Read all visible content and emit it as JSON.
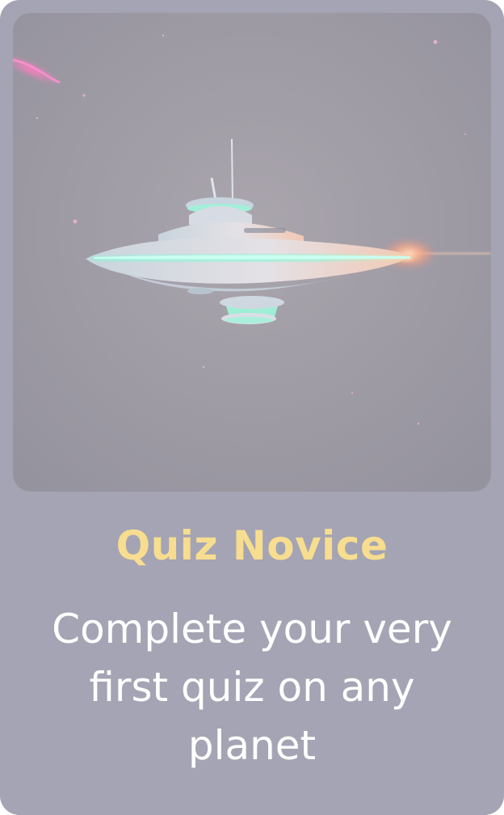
{
  "achievement": {
    "title": "Quiz Novice",
    "description": "Complete your very first quiz on any planet",
    "image_alt": "spaceship-illustration"
  },
  "colors": {
    "card_background": "#a4a4b4",
    "title": "#f7dd8f",
    "description": "#ffffff",
    "ship_glow": "#7ff2d6",
    "engine_flare": "#ffb08a"
  }
}
